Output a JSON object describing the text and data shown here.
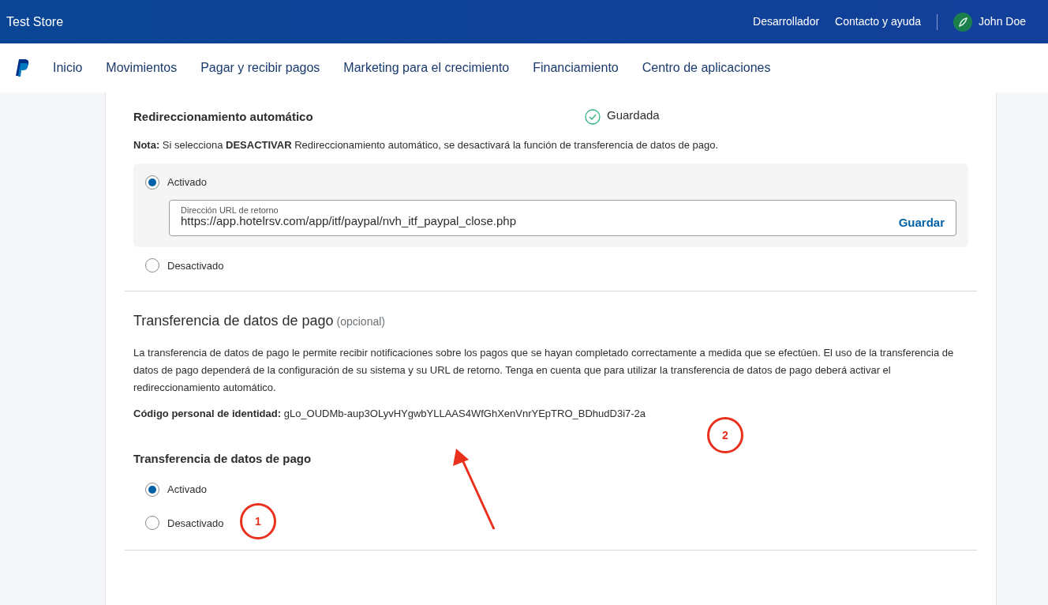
{
  "header": {
    "store_name": "Test Store",
    "links": [
      "Desarrollador",
      "Contacto y ayuda"
    ],
    "user_name": "John Doe"
  },
  "nav": {
    "items": [
      {
        "label": "Inicio",
        "selected": false
      },
      {
        "label": "Movimientos",
        "selected": false
      },
      {
        "label": "Pagar y recibir pagos",
        "selected": false
      },
      {
        "label": "Marketing para el crecimiento",
        "selected": false
      },
      {
        "label": "Financiamiento",
        "selected": false
      },
      {
        "label": "Centro de aplicaciones",
        "selected": false
      }
    ]
  },
  "auto_return": {
    "title": "Redireccionamiento automático",
    "status": "Guardada",
    "note": "**Nota:** Si selecciona **DESACTIVAR** Redireccionamiento automático, se desactivará la función de transferencia de datos de pago.",
    "options": [
      {
        "label": "Activado",
        "selected": true
      },
      {
        "label": "Desactivado",
        "selected": false
      }
    ],
    "url_field": {
      "label": "Dirección URL de retorno",
      "value": "https://app.hotelrsv.com/app/itf/paypal/nvh_itf_paypal_close.php",
      "button": "Guardar"
    }
  },
  "pdt": {
    "title": "Transferencia de datos de pago",
    "title_note": "(opcional)",
    "description": "La transferencia de datos de pago le permite recibir notificaciones sobre los pagos que se hayan completado correctamente a medida que se efectúen. El uso de la transferencia de datos de pago dependerá de la configuración de su sistema y su URL de retorno. Tenga en cuenta que para utilizar la transferencia de datos de pago deberá activar el redireccionamiento automático.",
    "identity_token": "**Código personal de identidad:** gLo_OUDMb-aup3OLyvHYgwbYLLAAS4WfGhXenVnrYEpTRO_BDhudD3i7-2a",
    "setting_title": "Transferencia de datos de pago",
    "options": [
      {
        "label": "Activado",
        "selected": true
      },
      {
        "label": "Desactivado",
        "selected": false
      }
    ]
  },
  "annotations": [
    {
      "label": "2"
    },
    {
      "label": "1"
    }
  ]
}
